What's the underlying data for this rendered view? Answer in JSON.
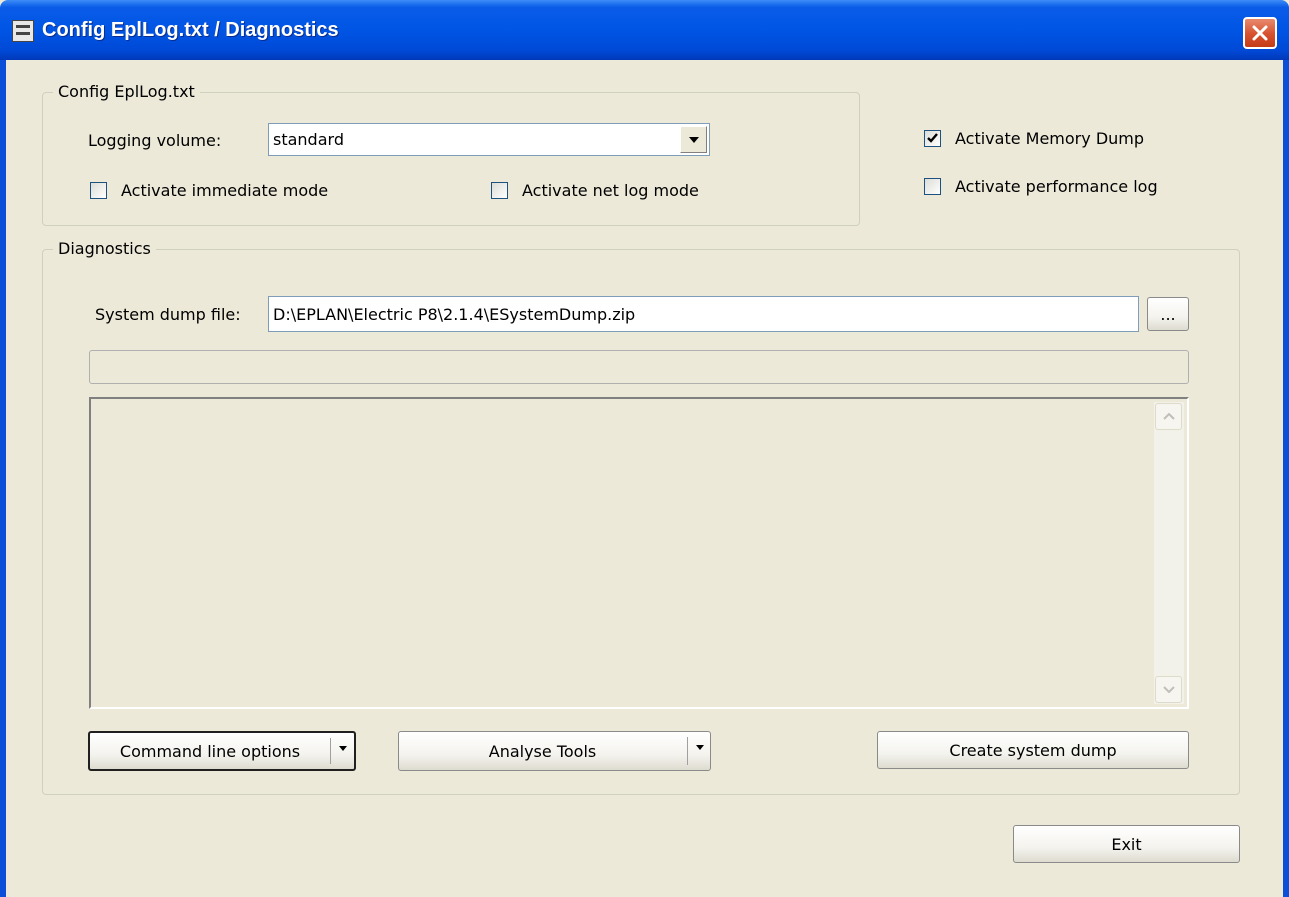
{
  "window": {
    "title": "Config EplLog.txt / Diagnostics"
  },
  "config_group": {
    "legend": "Config EplLog.txt",
    "logging_volume_label": "Logging volume:",
    "logging_volume_value": "standard",
    "immediate_mode_label": "Activate immediate mode",
    "immediate_mode_checked": false,
    "net_log_label": "Activate net log mode",
    "net_log_checked": false
  },
  "options": {
    "memory_dump_label": "Activate Memory Dump",
    "memory_dump_checked": true,
    "performance_log_label": "Activate performance log",
    "performance_log_checked": false
  },
  "diagnostics_group": {
    "legend": "Diagnostics",
    "dump_file_label": "System dump file:",
    "dump_file_value": "D:\\EPLAN\\Electric P8\\2.1.4\\ESystemDump.zip",
    "browse_label": "...",
    "progress_percent": 0,
    "output_text": "",
    "command_line_button": "Command line options",
    "analyse_tools_button": "Analyse Tools",
    "create_dump_button": "Create system dump"
  },
  "footer": {
    "exit_button": "Exit"
  },
  "colors": {
    "titlebar_blue": "#0055e5",
    "window_face": "#ece9d8",
    "close_red": "#d6512e",
    "checkbox_border": "#1c5180",
    "checkmark": "#21a121"
  }
}
